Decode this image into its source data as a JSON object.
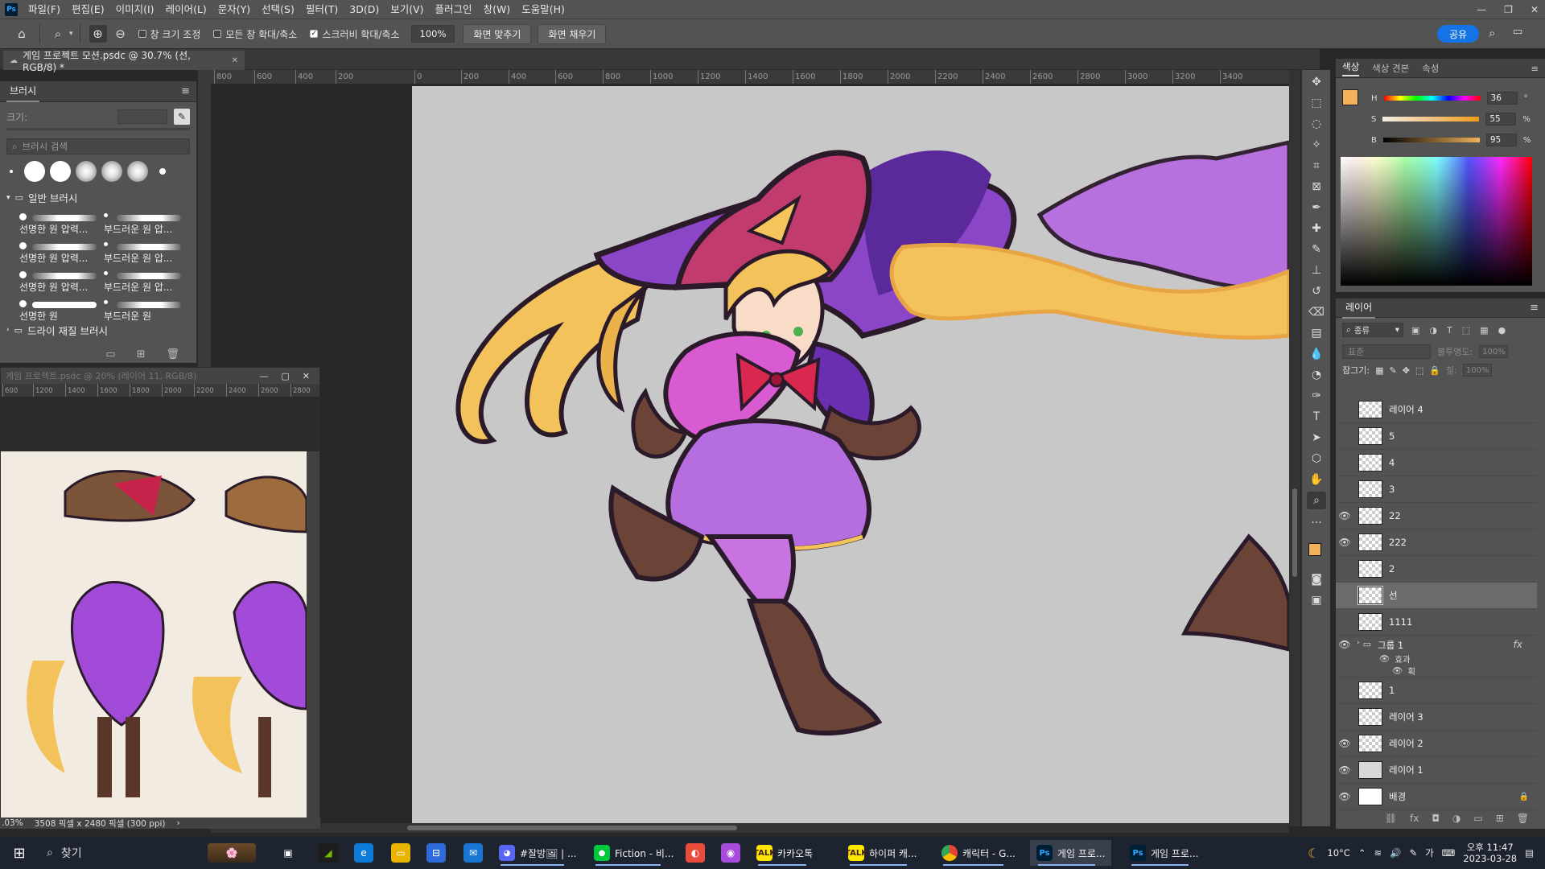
{
  "menu": [
    "파일(F)",
    "편집(E)",
    "이미지(I)",
    "레이어(L)",
    "문자(Y)",
    "선택(S)",
    "필터(T)",
    "3D(D)",
    "보기(V)",
    "플러그인",
    "창(W)",
    "도움말(H)"
  ],
  "options": {
    "resize_window": "창 크기 조정",
    "zoom_all": "모든 창 확대/축소",
    "scrubby_zoom": "스크러비 확대/축소",
    "zoom_value": "100%",
    "fit_screen": "화면 맞추기",
    "fill_screen": "화면 채우기",
    "share": "공유"
  },
  "document_tab": "게임 프로젝트 모션.psdc @ 30.7% (선, RGB/8) *",
  "ruler_ticks": [
    "800",
    "600",
    "400",
    "200",
    "0",
    "200",
    "400",
    "600",
    "800",
    "1000",
    "1200",
    "1400",
    "1600",
    "1800",
    "2000",
    "2200",
    "2400",
    "2600",
    "2800",
    "3000",
    "3200",
    "3400"
  ],
  "brush_panel": {
    "title": "브러시",
    "size_label": "크기:",
    "search_placeholder": "브러시 검색",
    "group_name": "일반 브러시",
    "group2_name": "드라이 재질 브러시",
    "brushes": [
      "선명한 원 압력...",
      "부드러운 원 압...",
      "선명한 원 압력...",
      "부드러운 원 압...",
      "선명한 원 압력...",
      "부드러운 원 압...",
      "선명한 원",
      "부드러운 원"
    ]
  },
  "navigator": {
    "title": "게임 프로젝트.psdc @ 20% (레이어 11, RGB/8)",
    "ruler": [
      "600",
      "1200",
      "1400",
      "1600",
      "1800",
      "2000",
      "2200",
      "2400",
      "2600",
      "2800"
    ],
    "status_zoom": ".03%",
    "status_size": "3508 픽셀 x 2480 픽셀 (300 ppi)"
  },
  "color_panel": {
    "tabs": [
      "색상",
      "색상 견본",
      "속성"
    ],
    "h_label": "H",
    "h_value": "36",
    "h_unit": "°",
    "s_label": "S",
    "s_value": "55",
    "s_unit": "%",
    "b_label": "B",
    "b_value": "95",
    "b_unit": "%",
    "foreground": "#f2b15a"
  },
  "layers_panel": {
    "title": "레이어",
    "filter": "종류",
    "blend": "표준",
    "opacity_label": "불투명도:",
    "opacity": "100%",
    "lock_label": "잠그기:",
    "fill_label": "칠:",
    "fill": "100%",
    "layers": [
      {
        "name": "레이어 4",
        "visible": false
      },
      {
        "name": "5",
        "visible": false
      },
      {
        "name": "4",
        "visible": false
      },
      {
        "name": "3",
        "visible": false
      },
      {
        "name": "22",
        "visible": true
      },
      {
        "name": "222",
        "visible": true
      },
      {
        "name": "2",
        "visible": false
      },
      {
        "name": "선",
        "visible": false,
        "selected": true
      },
      {
        "name": "1111",
        "visible": false
      }
    ],
    "group": {
      "name": "그룹 1",
      "effects": "효과",
      "effect": "획"
    },
    "layers_below": [
      {
        "name": "1",
        "visible": false
      },
      {
        "name": "레이어 3",
        "visible": false
      },
      {
        "name": "레이어 2",
        "visible": true
      },
      {
        "name": "레이어 1",
        "visible": true
      },
      {
        "name": "배경",
        "visible": true
      }
    ]
  },
  "taskbar": {
    "search": "찾기",
    "apps": [
      "#잘방🖼 | ...",
      "Fiction - 비...",
      "카카오톡",
      "하이퍼 캐...",
      "캐릭터 - G...",
      "게임 프로...",
      "게임 프로..."
    ],
    "weather": "10°C",
    "ime": "가",
    "time": "오후 11:47",
    "date": "2023-03-28"
  }
}
